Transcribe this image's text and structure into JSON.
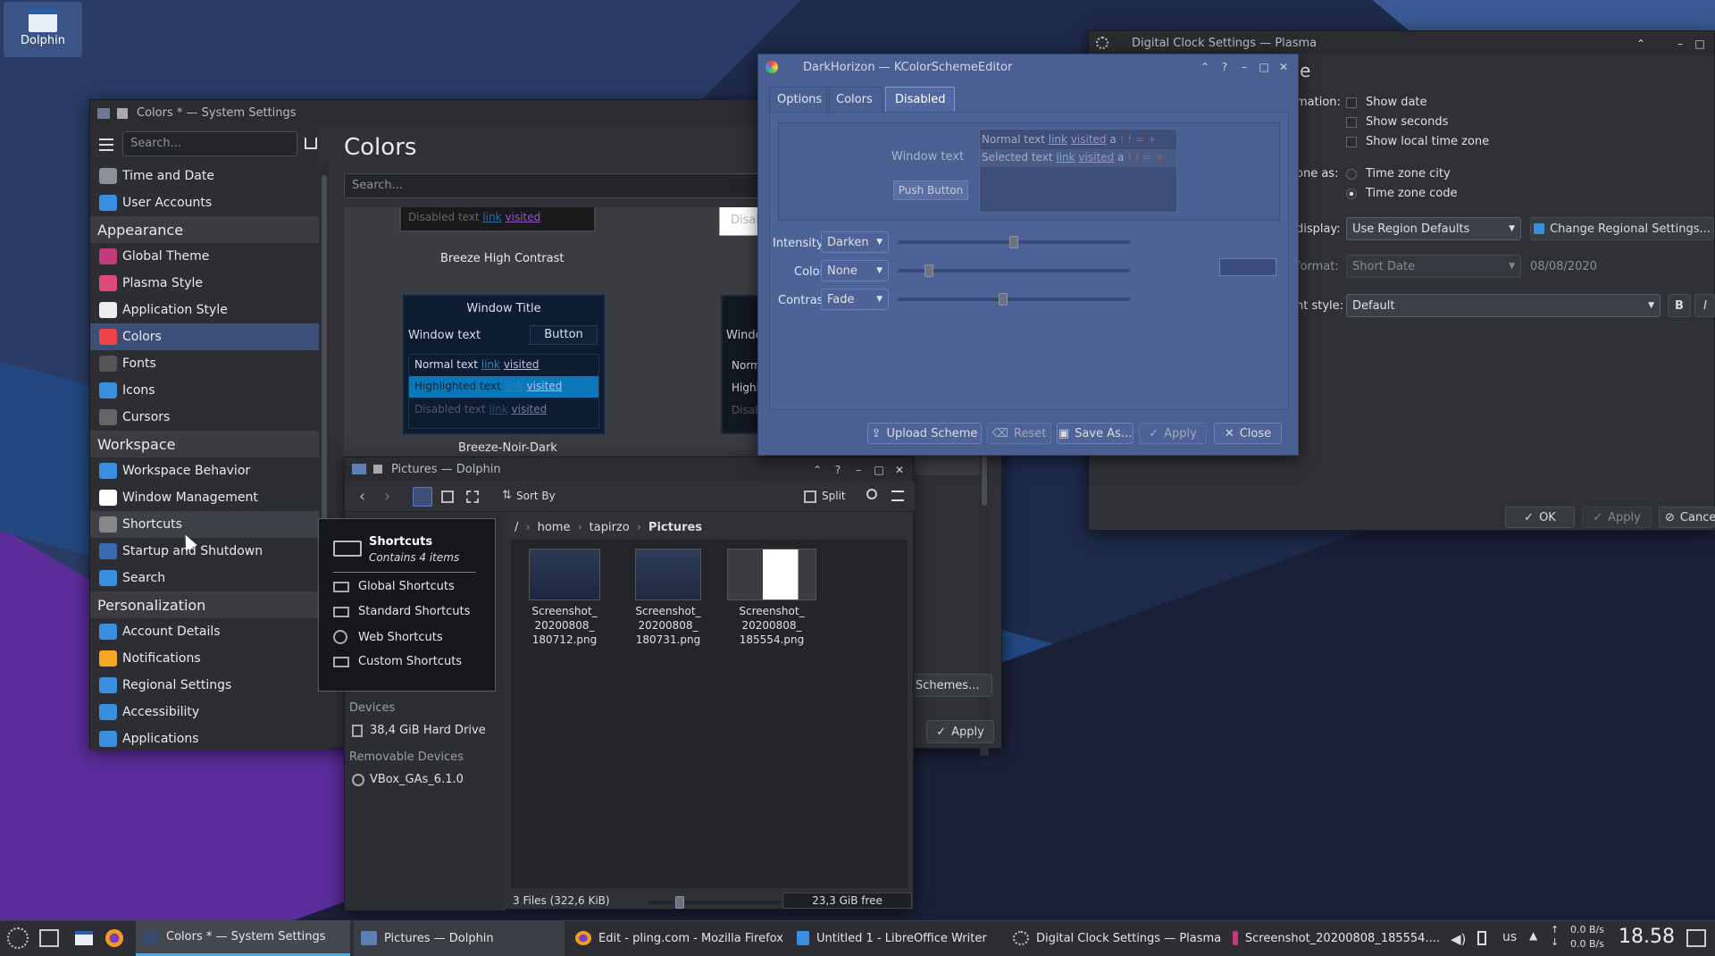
{
  "desktop": {
    "dolphin_icon_label": "Dolphin"
  },
  "system_settings": {
    "title": "Colors * — System Settings",
    "search_placeholder": "Search...",
    "page_title": "Colors",
    "content_search_placeholder": "Search...",
    "sidebar": {
      "top_items": [
        "Time and Date",
        "User Accounts"
      ],
      "appearance_header": "Appearance",
      "appearance_items": [
        "Global Theme",
        "Plasma Style",
        "Application Style",
        "Colors",
        "Fonts",
        "Icons",
        "Cursors"
      ],
      "workspace_header": "Workspace",
      "workspace_items": [
        "Workspace Behavior",
        "Window Management",
        "Shortcuts",
        "Startup and Shutdown",
        "Search"
      ],
      "personalization_header": "Personalization",
      "personalization_items": [
        "Account Details",
        "Notifications",
        "Regional Settings",
        "Accessibility",
        "Applications"
      ]
    },
    "schemes": {
      "hc_disabled_text": "Disabled text",
      "hc_link": "link",
      "hc_visited": "visited",
      "hc_name": "Breeze High Contrast",
      "partial_disab": "Disab",
      "preview_window_title": "Window Title",
      "preview_window_text": "Window text",
      "preview_button": "Button",
      "preview_normal_text": "Normal text",
      "preview_highlighted_text": "Highlighted text",
      "preview_disabled_text": "Disabled text",
      "preview_link": "link",
      "preview_visited": "visited",
      "noir_name": "Breeze-Noir-Dark",
      "partial_window": "Windo",
      "partial_norm": "Norm",
      "partial_highl": "Highl",
      "partial_disab2": "Disab"
    },
    "get_schemes_button": "r Schemes...",
    "apply_button": "Apply"
  },
  "tooltip": {
    "title": "Shortcuts",
    "subtitle": "Contains 4 items",
    "items": [
      "Global Shortcuts",
      "Standard Shortcuts",
      "Web Shortcuts",
      "Custom Shortcuts"
    ]
  },
  "dolphin": {
    "title": "Pictures — Dolphin",
    "sort_by": "Sort By",
    "split": "Split",
    "breadcrumb": [
      "/",
      "home",
      "tapirzo",
      "Pictures"
    ],
    "files": [
      {
        "name": "Screenshot_\n20200808_\n180712.png"
      },
      {
        "name": "Screenshot_\n20200808_\n180731.png"
      },
      {
        "name": "Screenshot_\n20200808_\n185554.png"
      }
    ],
    "devices_header": "Devices",
    "hard_drive": "38,4 GiB Hard Drive",
    "removable_header": "Removable Devices",
    "removable_item": "VBox_GAs_6.1.0",
    "status": "3 Files (322,6 KiB)",
    "free_space": "23,3 GiB free"
  },
  "kcolor": {
    "title": "DarkHorizon — KColorSchemeEditor",
    "tabs": [
      "Options",
      "Colors",
      "Disabled"
    ],
    "window_text": "Window text",
    "push_button": "Push Button",
    "normal_text": "Normal text",
    "selected_text": "Selected text",
    "link": "link",
    "visited": "visited",
    "a": "a",
    "marks": "! ! = +",
    "intensity_label": "Intensity:",
    "intensity_value": "Darken",
    "color_label": "Color:",
    "color_value": "None",
    "contrast_label": "Contrast:",
    "contrast_value": "Fade",
    "intensity_level": 0.5,
    "color_level": 0.12,
    "contrast_level": 0.45,
    "buttons": {
      "upload": "Upload Scheme",
      "reset": "Reset",
      "save_as": "Save As...",
      "apply": "Apply",
      "close": "Close"
    }
  },
  "clock": {
    "title": "Digital Clock Settings — Plasma",
    "heading_partial": "e",
    "information_label": "mation:",
    "show_date": "Show date",
    "show_seconds": "Show seconds",
    "show_local_tz": "Show local time zone",
    "tz_label": "one as:",
    "tz_city": "Time zone city",
    "tz_code": "Time zone code",
    "display_label": "display:",
    "display_value": "Use Region Defaults",
    "change_regional": "Change Regional Settings...",
    "format_label": "format:",
    "format_value": "Short Date",
    "format_example": "08/08/2020",
    "font_style_label": "nt style:",
    "font_style_value": "Default",
    "bold": "B",
    "italic": "I",
    "ok": "OK",
    "apply": "Apply",
    "cancel": "Cancel"
  },
  "taskbar": {
    "tasks": [
      "Colors * — System Settings",
      "Pictures — Dolphin",
      "Edit - pling.com - Mozilla Firefox",
      "Untitled 1 - LibreOffice Writer",
      "Digital Clock Settings — Plasma",
      "Screenshot_20200808_185554...."
    ],
    "keyboard_layout": "us",
    "net_up": "0.0 B/s",
    "net_down": "0.0 B/s",
    "clock": "18.58"
  },
  "colors": {
    "selection": "#3d4f78",
    "accent": "#2f6ea8",
    "kcolor_bg": "#4a5f92",
    "highlight_row": "#0a78b8"
  }
}
